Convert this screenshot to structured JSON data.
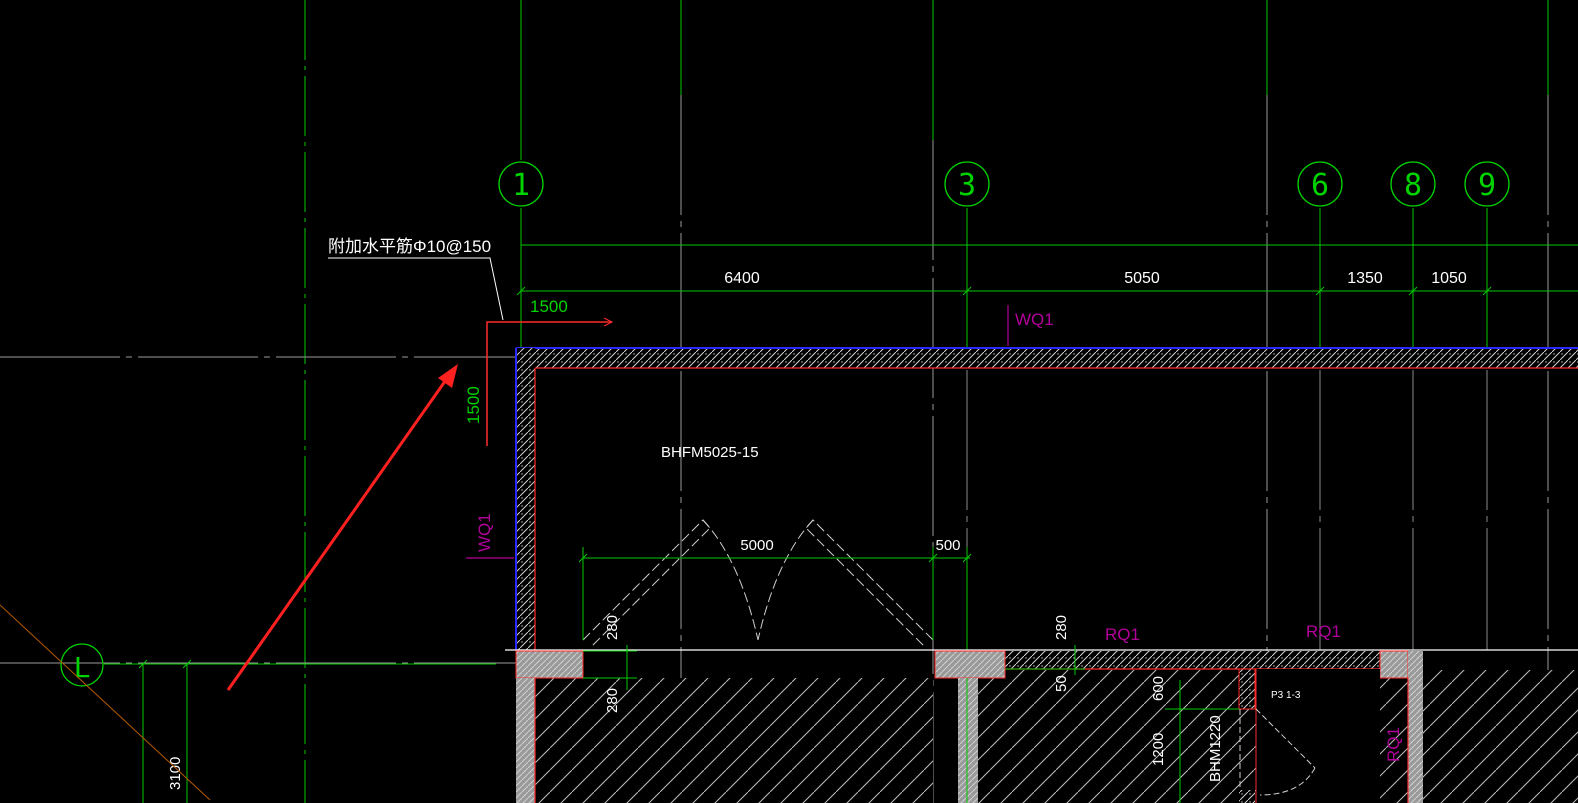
{
  "colors": {
    "background": "#000000",
    "axis_green": "#00d400",
    "grid_white": "#c8c8c8",
    "wall_red": "#ff2a2a",
    "hatch_white": "#bfbfbf",
    "blue_edge": "#2a2aff",
    "magenta": "#b2009a",
    "arrow_red": "#ff2020",
    "text_white": "#ffffff",
    "orange_line": "#b85a00"
  },
  "axes": {
    "a1": "1",
    "a3": "3",
    "a6": "6",
    "a8": "8",
    "a9": "9",
    "aL": "L"
  },
  "dimensions": {
    "d6400": "6400",
    "d5050": "5050",
    "d1350": "1350",
    "d1050": "1050",
    "d1500_h": "1500",
    "d1500_v": "1500",
    "d5000": "5000",
    "d500": "500",
    "d280_a": "280",
    "d280_b": "280",
    "d280_c": "280",
    "d50": "50",
    "d600": "600",
    "d1200": "1200",
    "d3100": "3100"
  },
  "labels": {
    "rebar_note": "附加水平筋Φ10@150",
    "door_bhfm": "BHFM5025-15",
    "door_bhm": "BHM1220",
    "wq1_top": "WQ1",
    "wq1_left": "WQ1",
    "rq1_a": "RQ1",
    "rq1_b": "RQ1",
    "rq1_c": "RQ1",
    "small_note": "P3  1-3"
  }
}
